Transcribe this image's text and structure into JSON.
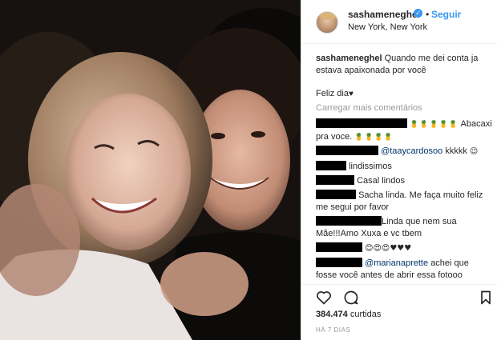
{
  "post": {
    "username": "sashameneghel",
    "verified_mark": "✓",
    "separator": "•",
    "follow_label": "Seguir",
    "location": "New York, New York"
  },
  "caption": {
    "username": "sashameneghel",
    "text": "Quando me dei conta ja estava apaixonada por você",
    "line2": "Feliz dia",
    "line2_emoji": "♥"
  },
  "load_more": "Carregar mais comentários",
  "comments": [
    {
      "text": "Abacaxi",
      "pre_emoji": "🍍🍍🍍🍍🍍",
      "cont": "pra voce.",
      "post_emoji": "🍍🍍🍍🍍"
    },
    {
      "mention": "@taaycardosoo",
      "text": "kkkkk",
      "emoji": "😉"
    },
    {
      "text": "lindissimos"
    },
    {
      "text": "Casal lindos"
    },
    {
      "text": "Sacha linda. Me faça muito feliz",
      "cont": "me segui por favor"
    },
    {
      "text": "Linda que nem sua",
      "cont": "Mãe!!!Amo Xuxa e vc tbem"
    },
    {
      "emoji": "😊😍😍♥♥♥"
    },
    {
      "mention": "@marianaprette",
      "text": "achei que",
      "cont": "fosse você antes de abrir essa fotooo"
    }
  ],
  "actions": {
    "heart_icon": "heart-outline-icon",
    "comment_icon": "comment-bubble-icon",
    "save_icon": "bookmark-icon"
  },
  "likes": {
    "count": "384.474",
    "label": "curtidas"
  },
  "time_ago": "HÁ 7 DIAS"
}
